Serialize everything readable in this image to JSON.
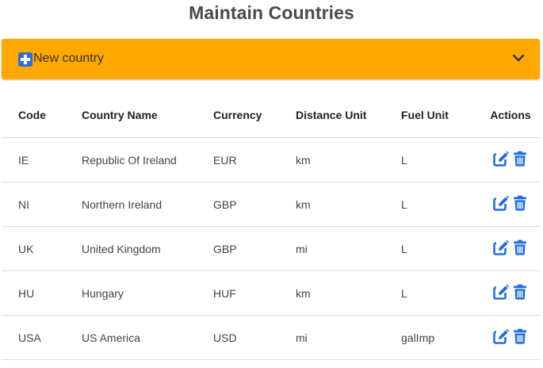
{
  "page": {
    "title": "Maintain Countries"
  },
  "accordion": {
    "label": "New country",
    "expanded": false
  },
  "table": {
    "headers": {
      "code": "Code",
      "name": "Country Name",
      "currency": "Currency",
      "distance_unit": "Distance Unit",
      "fuel_unit": "Fuel Unit",
      "actions": "Actions"
    },
    "rows": [
      {
        "code": "IE",
        "name": "Republic Of Ireland",
        "currency": "EUR",
        "distance_unit": "km",
        "fuel_unit": "L"
      },
      {
        "code": "NI",
        "name": "Northern Ireland",
        "currency": "GBP",
        "distance_unit": "km",
        "fuel_unit": "L"
      },
      {
        "code": "UK",
        "name": "United Kingdom",
        "currency": "GBP",
        "distance_unit": "mi",
        "fuel_unit": "L"
      },
      {
        "code": "HU",
        "name": "Hungary",
        "currency": "HUF",
        "distance_unit": "km",
        "fuel_unit": "L"
      },
      {
        "code": "USA",
        "name": "US America",
        "currency": "USD",
        "distance_unit": "mi",
        "fuel_unit": "galImp"
      }
    ]
  },
  "icons": {
    "add": "plus-square-icon",
    "expand": "chevron-down-icon",
    "edit": "edit-icon",
    "delete": "trash-icon"
  },
  "colors": {
    "accordion_bg": "#ffa800",
    "action_blue": "#1f6fe0",
    "add_icon_blue": "#2b6fd6"
  }
}
